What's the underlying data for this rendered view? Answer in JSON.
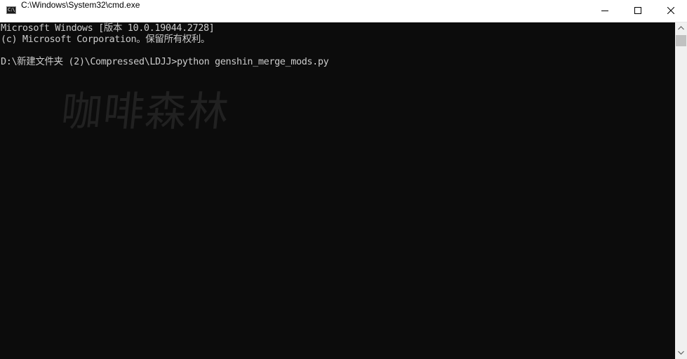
{
  "window": {
    "title": "C:\\Windows\\System32\\cmd.exe",
    "app_icon_text": "C:\\",
    "controls": [
      "minimize",
      "maximize",
      "close"
    ]
  },
  "console": {
    "lines": [
      "Microsoft Windows [版本 10.0.19044.2728]",
      "(c) Microsoft Corporation。保留所有权利。",
      "",
      "D:\\新建文件夹 (2)\\Compressed\\LDJJ>python genshin_merge_mods.py"
    ],
    "watermark": "咖啡森林"
  },
  "colors": {
    "console_background": "#0c0c0c",
    "console_text": "#cccccc",
    "titlebar_background": "#ffffff",
    "scrollbar_track": "#f0f0f0",
    "scrollbar_thumb": "#c1c1c1"
  }
}
